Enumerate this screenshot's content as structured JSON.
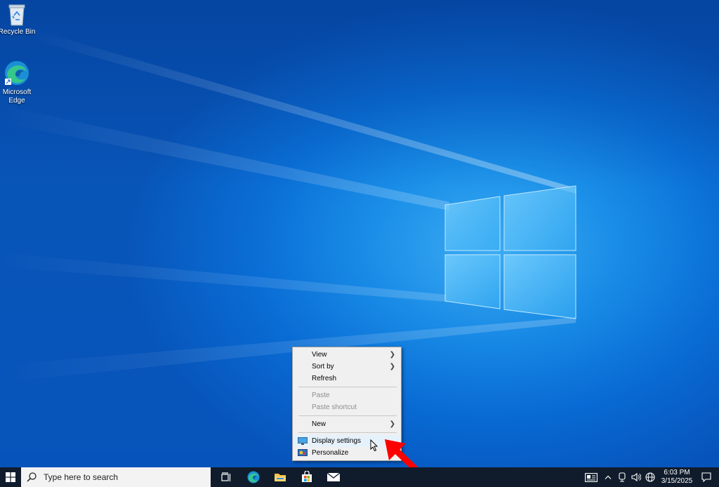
{
  "desktop": {
    "icons": [
      {
        "label": "Recycle Bin",
        "icon": "recycle-bin-icon"
      },
      {
        "label": "Microsoft\nEdge",
        "label_line1": "Microsoft",
        "label_line2": "Edge",
        "icon": "edge-icon"
      }
    ]
  },
  "context_menu": {
    "items": [
      {
        "label": "View",
        "submenu": true,
        "enabled": true
      },
      {
        "label": "Sort by",
        "submenu": true,
        "enabled": true
      },
      {
        "label": "Refresh",
        "enabled": true
      },
      {
        "label": "Paste",
        "enabled": false
      },
      {
        "label": "Paste shortcut",
        "enabled": false
      },
      {
        "label": "New",
        "submenu": true,
        "enabled": true
      },
      {
        "label": "Display settings",
        "icon": "display-settings-icon",
        "enabled": true,
        "highlighted": true
      },
      {
        "label": "Personalize",
        "icon": "personalize-icon",
        "enabled": true
      }
    ]
  },
  "taskbar": {
    "search_placeholder": "Type here to search",
    "apps": [
      "task-view-icon",
      "edge-icon",
      "file-explorer-icon",
      "store-icon",
      "mail-icon"
    ],
    "tray_icons": [
      "news-icon",
      "chevron-up-icon",
      "meet-icon",
      "volume-icon",
      "network-icon"
    ],
    "time": "6:03 PM",
    "date": "3/15/2025"
  },
  "colors": {
    "taskbar": "#101c2c",
    "menu_bg": "#f0f0f0",
    "menu_hover": "#e5f1fb",
    "annotation_arrow": "#ff0000"
  }
}
